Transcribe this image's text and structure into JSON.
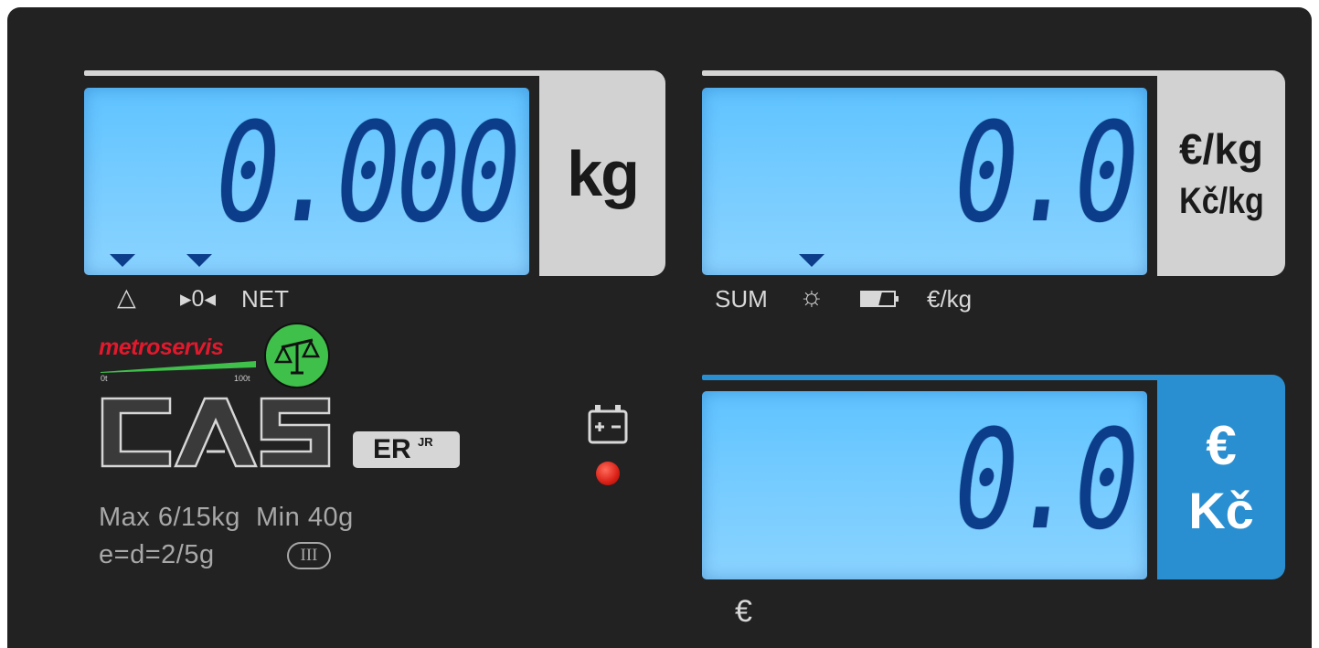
{
  "weight": {
    "value": "0.000",
    "unit": "kg",
    "indicators": [
      "△",
      "▸0◂",
      "NET"
    ]
  },
  "unit_price": {
    "value": "0.0",
    "units": [
      "€/kg",
      "Kč/kg"
    ],
    "indicators": [
      "SUM",
      "☼",
      "€/kg"
    ]
  },
  "total_price": {
    "value": "0.0",
    "currencies": [
      "€",
      "Kč"
    ],
    "indicator": "€"
  },
  "branding": {
    "dealer": "metroservis",
    "dealer_scale_min": "0t",
    "dealer_scale_max": "100t",
    "brand": "CAS",
    "model": "ER",
    "model_suffix": "JR"
  },
  "specs": {
    "line1": "Max 6/15kg  Min 40g",
    "line2": "e=d=2/5g",
    "accuracy_class": "III"
  },
  "icons": {
    "battery": "battery-icon",
    "power_led": "power-led-icon",
    "battery_indicator": "battery-level-icon"
  },
  "colors": {
    "lcd": "#74cbff",
    "digits": "#0c3d8a",
    "currency_box": "#2a8fd0",
    "led": "#e32a20",
    "dealer_red": "#e2192c",
    "dealer_green": "#3fc04a"
  }
}
